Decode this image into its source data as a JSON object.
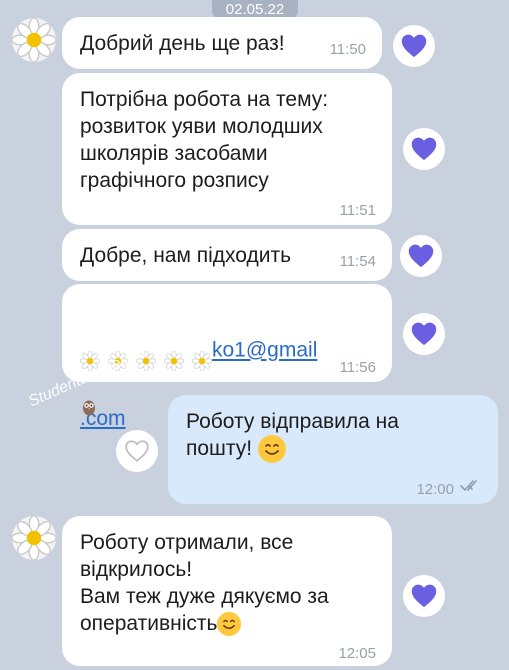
{
  "date_badge": "02.05.22",
  "messages": [
    {
      "text": "Добрий день ще раз!",
      "time": "11:50"
    },
    {
      "text": "Потрібна робота на тему:\nрозвиток уяви молодших\nшколярів засобами\nграфічного розпису",
      "time": "11:51"
    },
    {
      "text": "Добре, нам підходить",
      "time": "11:54"
    },
    {
      "email_suffix": "ko1@gmail",
      "email_domain": ".com",
      "time": "11:56"
    },
    {
      "text": "Роботу відправила на\nпошту!",
      "time": "12:00"
    },
    {
      "text": "Роботу отримали, все\nвідкрилось!\nВам теж дуже дякуємо за\nоперативність",
      "time": "12:05"
    }
  ],
  "watermark": "Studentam.net.ua",
  "icons": {
    "reaction": "heart-icon",
    "avatar": "daisy-icon",
    "read_status": "double-check-icon",
    "emoji": "smile-emoji-icon"
  },
  "colors": {
    "background": "#c9d0de",
    "incoming_bubble": "#ffffff",
    "outgoing_bubble": "#d8e9fb",
    "heart": "#6a5fe0",
    "link": "#2a6cc9"
  }
}
